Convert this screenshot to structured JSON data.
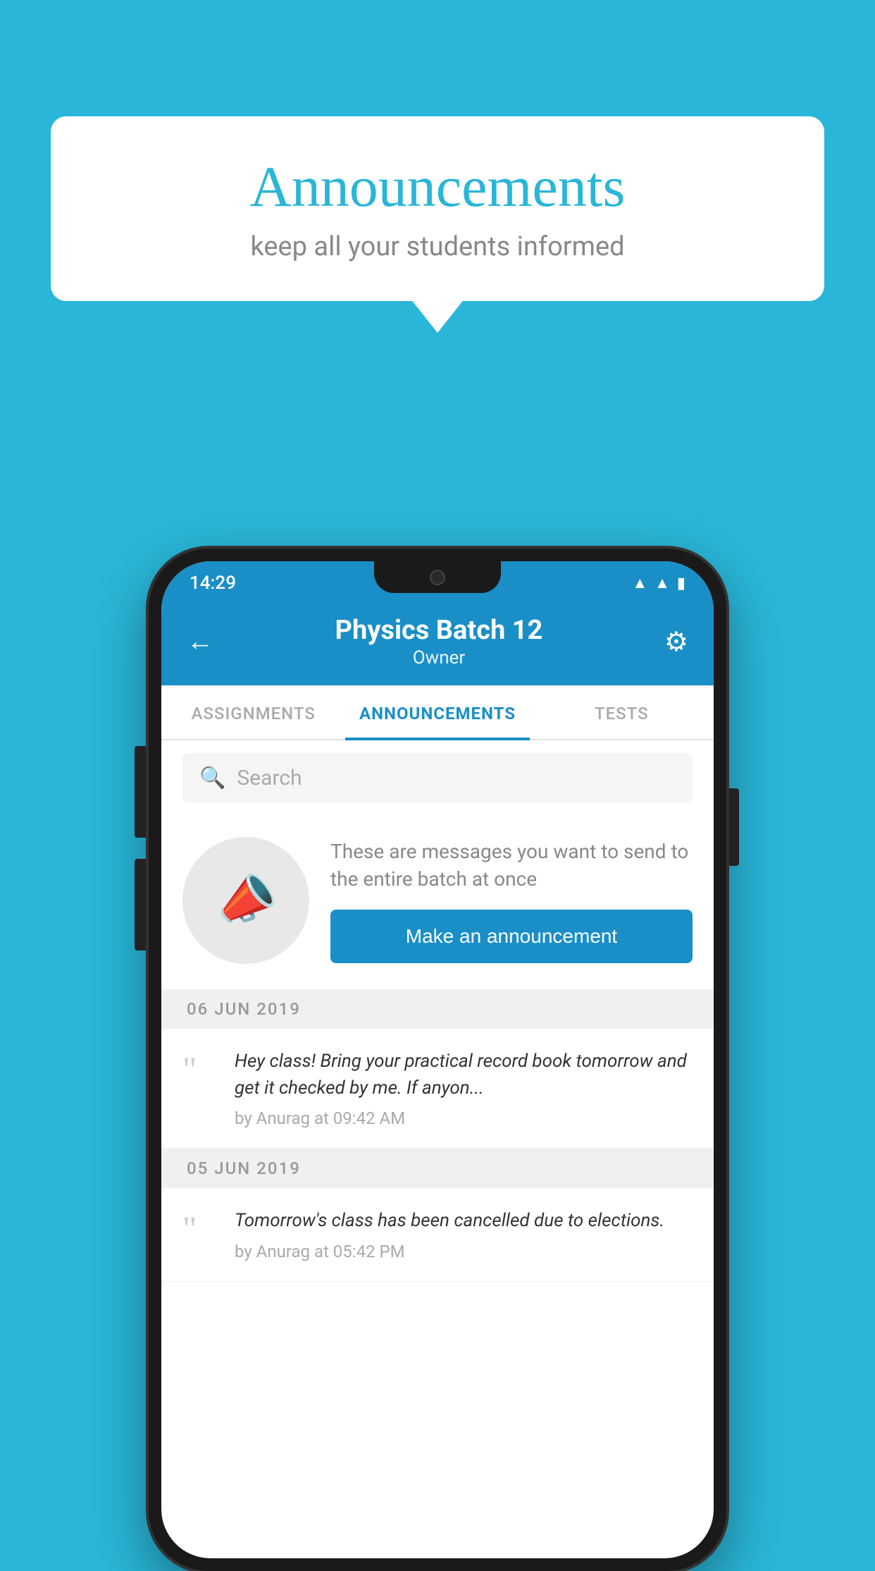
{
  "background": {
    "color": "#29b6d8"
  },
  "speech_bubble": {
    "title": "Announcements",
    "subtitle": "keep all your students informed"
  },
  "phone": {
    "status_bar": {
      "time": "14:29"
    },
    "header": {
      "title": "Physics Batch 12",
      "subtitle": "Owner",
      "back_label": "←",
      "gear_label": "⚙"
    },
    "tabs": [
      {
        "label": "ASSIGNMENTS",
        "active": false
      },
      {
        "label": "ANNOUNCEMENTS",
        "active": true
      },
      {
        "label": "TESTS",
        "active": false
      }
    ],
    "search": {
      "placeholder": "Search"
    },
    "promo": {
      "description": "These are messages you want to send to the entire batch at once",
      "button_label": "Make an announcement"
    },
    "announcements": [
      {
        "date": "06  JUN  2019",
        "text": "Hey class! Bring your practical record book tomorrow and get it checked by me. If anyon...",
        "meta": "by Anurag at 09:42 AM"
      },
      {
        "date": "05  JUN  2019",
        "text": "Tomorrow's class has been cancelled due to elections.",
        "meta": "by Anurag at 05:42 PM"
      }
    ]
  }
}
